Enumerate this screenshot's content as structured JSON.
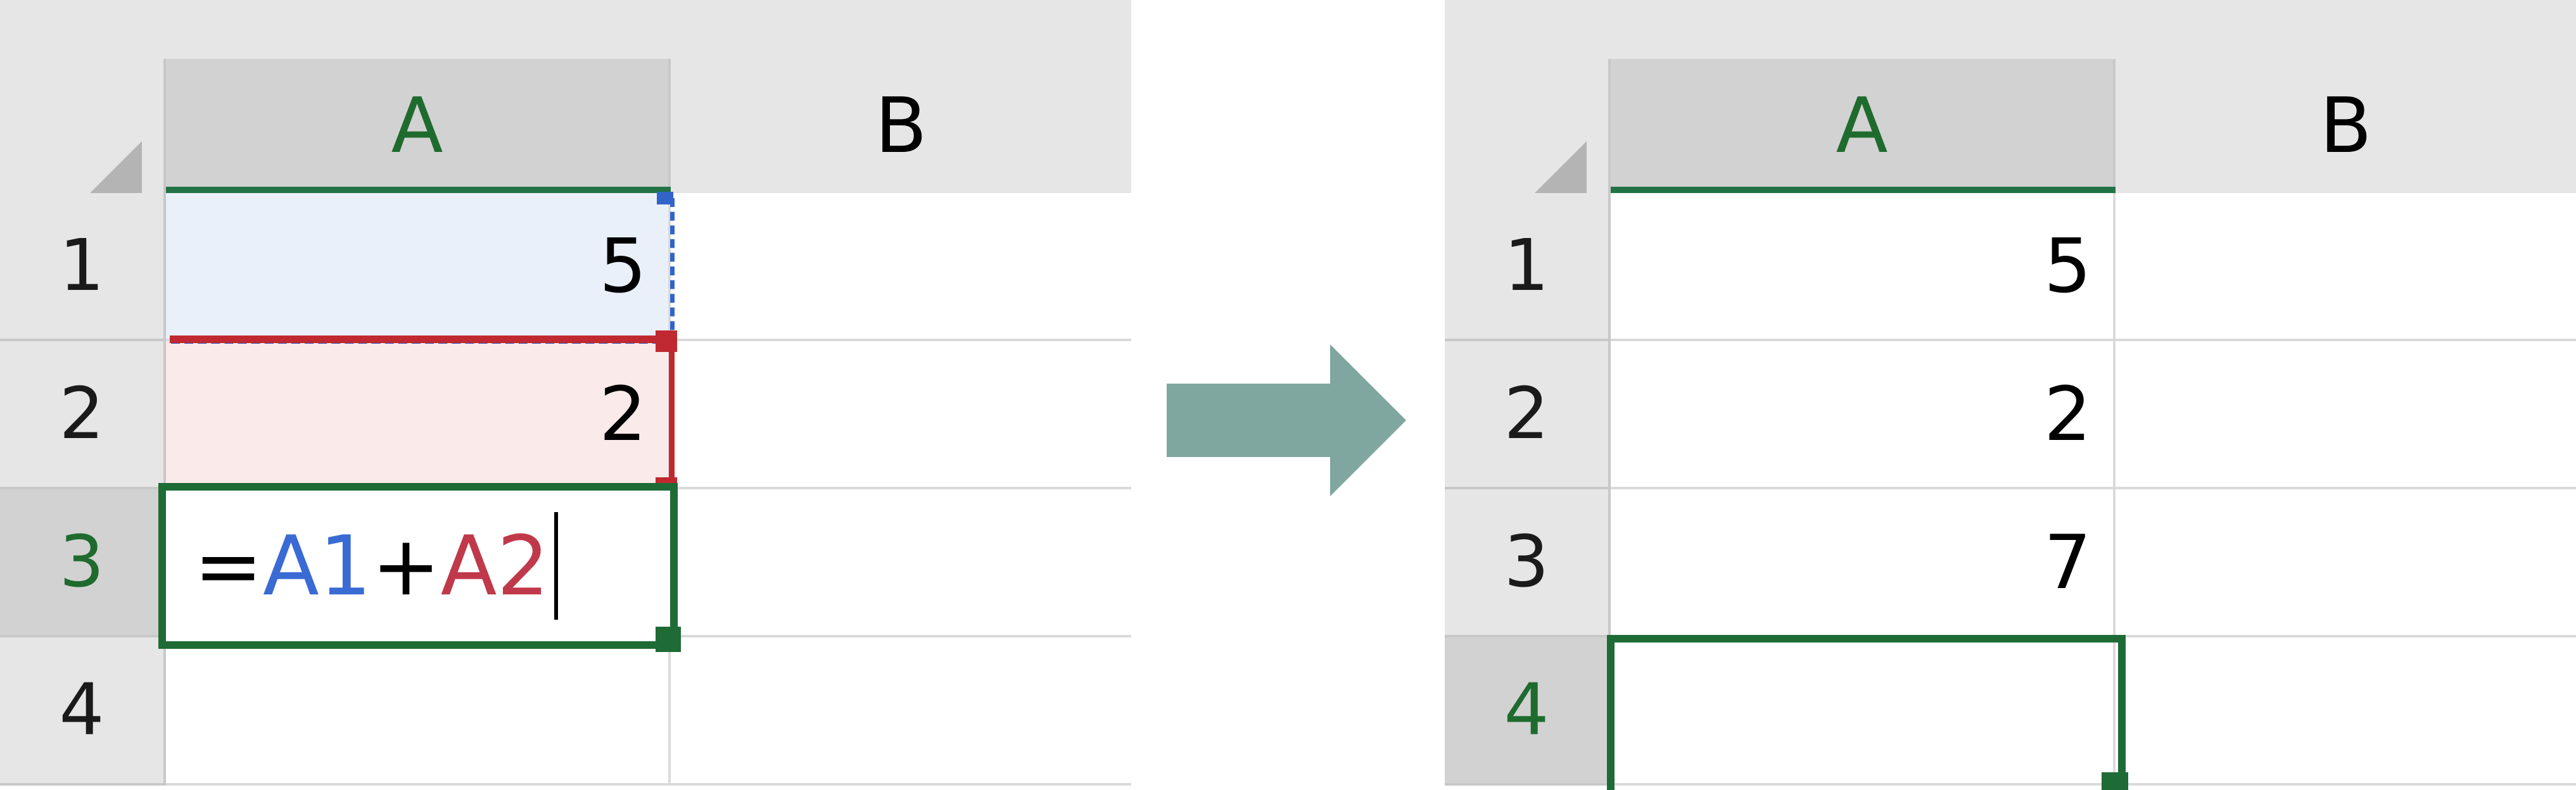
{
  "columns": [
    "A",
    "B"
  ],
  "rows": [
    "1",
    "2",
    "3",
    "4"
  ],
  "before": {
    "cells": {
      "A1": "5",
      "A2": "2",
      "A3": "",
      "A4": ""
    },
    "formula": {
      "equals": "=",
      "ref1": "A1",
      "plus": "+",
      "ref2": "A2"
    },
    "active_cell": "A3"
  },
  "after": {
    "cells": {
      "A1": "5",
      "A2": "2",
      "A3": "7",
      "A4": ""
    },
    "active_cell": "A4"
  },
  "colors": {
    "selection_green": "#1e6b36",
    "ref1_blue": "#3a6ad4",
    "ref2_red": "#c0394a",
    "arrow_fill": "#7fa69f"
  },
  "icons": [
    "select-all-corner-icon",
    "right-arrow-icon"
  ]
}
